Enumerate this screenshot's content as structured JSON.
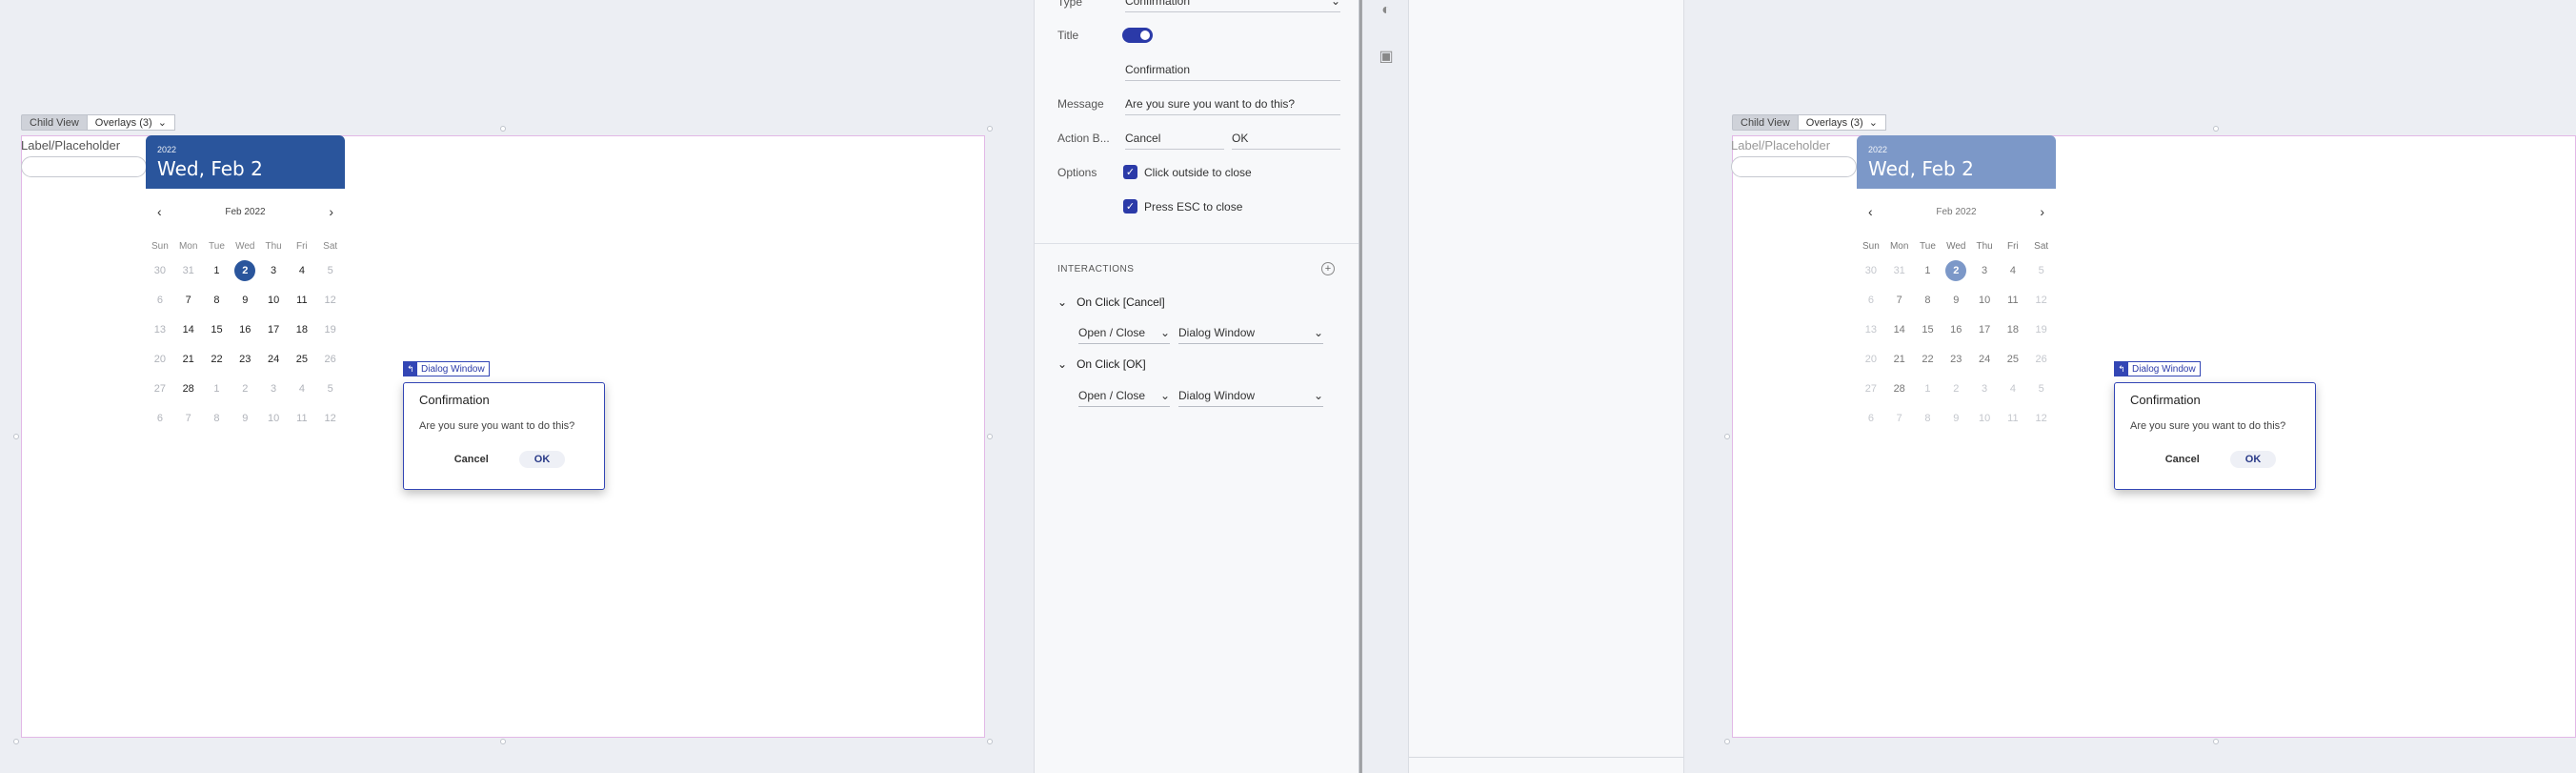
{
  "breadcrumb": {
    "child_view": "Child View",
    "overlays": "Overlays (3)"
  },
  "form": {
    "label": "Label/Placeholder"
  },
  "calendar": {
    "year": "2022",
    "date": "Wed, Feb 2",
    "month_label": "Feb 2022",
    "weekdays": [
      "Sun",
      "Mon",
      "Tue",
      "Wed",
      "Thu",
      "Fri",
      "Sat"
    ],
    "weeks": [
      [
        "30",
        "31",
        "1",
        "2",
        "3",
        "4",
        "5"
      ],
      [
        "6",
        "7",
        "8",
        "9",
        "10",
        "11",
        "12"
      ],
      [
        "13",
        "14",
        "15",
        "16",
        "17",
        "18",
        "19"
      ],
      [
        "20",
        "21",
        "22",
        "23",
        "24",
        "25",
        "26"
      ],
      [
        "27",
        "28",
        "1",
        "2",
        "3",
        "4",
        "5"
      ],
      [
        "6",
        "7",
        "8",
        "9",
        "10",
        "11",
        "12"
      ]
    ]
  },
  "dialog": {
    "tag_label": "Dialog Window",
    "title": "Confirmation",
    "message": "Are you sure you want to do this?",
    "cancel": "Cancel",
    "ok": "OK"
  },
  "properties": {
    "type_label": "Type",
    "type_value": "Confirmation",
    "title_label": "Title",
    "title_enabled": true,
    "title_value": "Confirmation",
    "message_label": "Message",
    "message_value": "Are you sure you want to do this?",
    "action_label": "Action B...",
    "action_cancel": "Cancel",
    "action_ok": "OK",
    "options_label": "Options",
    "option_click_outside": "Click outside to close",
    "option_press_esc": "Press ESC to close"
  },
  "interactions": {
    "section_title": "INTERACTIONS",
    "items": [
      {
        "label": "On Click [Cancel]",
        "action": "Open / Close",
        "target": "Dialog Window"
      },
      {
        "label": "On Click [OK]",
        "action": "Open / Close",
        "target": "Dialog Window"
      }
    ]
  },
  "colors": {
    "accent": "#2b3aa8",
    "calendar_header": "#2a559c",
    "frame_border": "#e2b8e6"
  },
  "icons": [
    "palette-icon",
    "save-icon",
    "chevron-down-icon",
    "chevron-left-icon",
    "chevron-right-icon",
    "plus-circle-icon",
    "check-icon"
  ]
}
